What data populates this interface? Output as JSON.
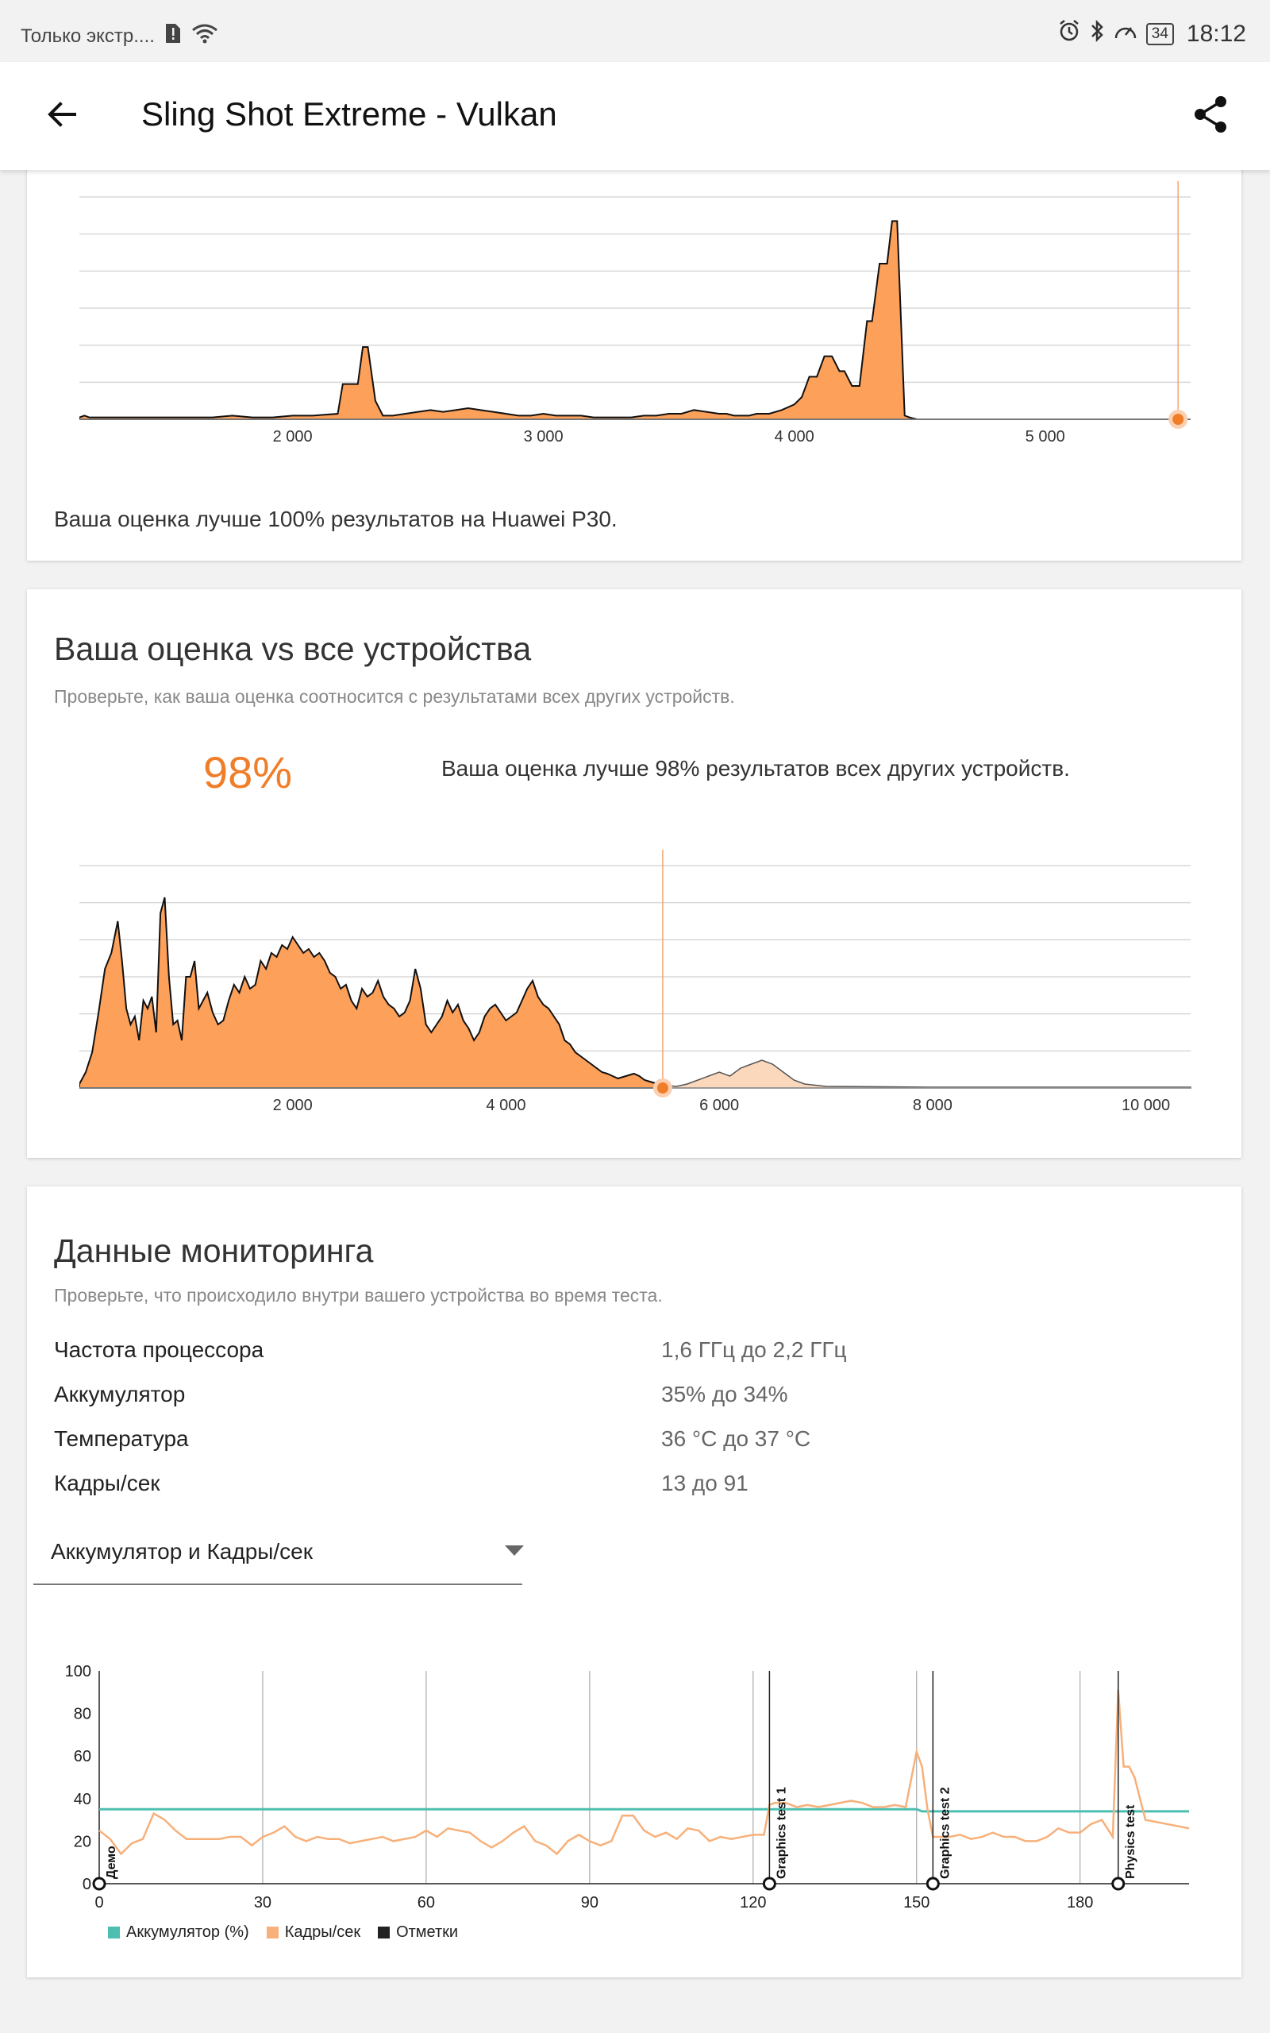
{
  "status_bar": {
    "carrier_text": "Только экстр....",
    "time": "18:12",
    "battery_level": "34"
  },
  "app_bar": {
    "title": "Sling Shot Extreme - Vulkan"
  },
  "card_model": {
    "summary": "Ваша оценка лучше 100% результатов на Huawei P30.",
    "chart_data": {
      "type": "area",
      "xticks": [
        "2 000",
        "3 000",
        "4 000",
        "5 000"
      ],
      "xlim": [
        1150,
        5580
      ],
      "x": [
        1150,
        1170,
        1190,
        1600,
        1680,
        1760,
        1840,
        1920,
        2000,
        2080,
        2180,
        2200,
        2230,
        2260,
        2280,
        2300,
        2330,
        2360,
        2400,
        2450,
        2500,
        2550,
        2600,
        2650,
        2700,
        2750,
        2800,
        2850,
        2900,
        2950,
        3000,
        3050,
        3100,
        3150,
        3200,
        3250,
        3300,
        3350,
        3400,
        3450,
        3500,
        3550,
        3600,
        3650,
        3700,
        3730,
        3760,
        3790,
        3820,
        3850,
        3900,
        3950,
        4000,
        4030,
        4060,
        4090,
        4120,
        4150,
        4180,
        4200,
        4230,
        4260,
        4290,
        4310,
        4340,
        4370,
        4390,
        4410,
        4440,
        4460,
        4490,
        5580
      ],
      "values": [
        1,
        2,
        1,
        1,
        1,
        2,
        1,
        1,
        2,
        2,
        3,
        19,
        19,
        19,
        39,
        39,
        10,
        2,
        2,
        3,
        4,
        5,
        4,
        5,
        6,
        5,
        4,
        3,
        2,
        2,
        3,
        2,
        2,
        2,
        1,
        1,
        1,
        1,
        2,
        2,
        3,
        3,
        5,
        4,
        3,
        3,
        2,
        2,
        2,
        3,
        3,
        5,
        8,
        12,
        23,
        23,
        34,
        34,
        26,
        26,
        18,
        18,
        53,
        53,
        84,
        84,
        107,
        107,
        2,
        1,
        0,
        0
      ],
      "ylim": [
        0,
        120
      ],
      "marker_x": 5530
    }
  },
  "card_all": {
    "heading": "Ваша оценка vs все устройства",
    "subtitle": "Проверьте, как ваша оценка соотносится с результатами всех других устройств.",
    "percentile": "98%",
    "summary": "Ваша оценка лучше 98% результатов всех других устройств.",
    "chart_data": {
      "type": "area",
      "xticks": [
        "2 000",
        "4 000",
        "6 000",
        "8 000",
        "10 000"
      ],
      "xlim": [
        0,
        10420
      ],
      "x": [
        0,
        60,
        120,
        180,
        240,
        300,
        360,
        400,
        440,
        480,
        520,
        560,
        600,
        640,
        680,
        720,
        760,
        800,
        840,
        880,
        920,
        960,
        1000,
        1040,
        1080,
        1120,
        1160,
        1200,
        1250,
        1300,
        1350,
        1400,
        1450,
        1500,
        1550,
        1600,
        1650,
        1700,
        1750,
        1800,
        1850,
        1900,
        1950,
        2000,
        2050,
        2100,
        2150,
        2200,
        2250,
        2300,
        2350,
        2400,
        2450,
        2500,
        2550,
        2600,
        2650,
        2700,
        2750,
        2800,
        2850,
        2900,
        2950,
        3000,
        3050,
        3100,
        3150,
        3200,
        3250,
        3300,
        3350,
        3400,
        3450,
        3500,
        3550,
        3600,
        3650,
        3700,
        3750,
        3800,
        3850,
        3900,
        3950,
        4000,
        4050,
        4100,
        4150,
        4200,
        4250,
        4300,
        4350,
        4400,
        4450,
        4500,
        4550,
        4600,
        4650,
        4700,
        4750,
        4800,
        4850,
        4900,
        4950,
        5000,
        5050,
        5100,
        5150,
        5200,
        5250,
        5300,
        5350,
        5400,
        5450,
        5500,
        5600,
        5700,
        5800,
        5900,
        6000,
        6100,
        6200,
        6300,
        6400,
        6500,
        6600,
        6700,
        6800,
        7000,
        8000,
        9000,
        10000,
        10420
      ],
      "values": [
        5,
        20,
        45,
        95,
        150,
        170,
        210,
        160,
        100,
        80,
        90,
        60,
        110,
        100,
        115,
        70,
        220,
        240,
        140,
        80,
        85,
        60,
        140,
        140,
        160,
        100,
        110,
        120,
        95,
        80,
        85,
        110,
        130,
        120,
        140,
        125,
        130,
        160,
        150,
        170,
        165,
        180,
        175,
        190,
        180,
        170,
        175,
        165,
        170,
        160,
        145,
        140,
        125,
        130,
        110,
        100,
        125,
        115,
        120,
        135,
        115,
        105,
        100,
        90,
        95,
        110,
        150,
        125,
        80,
        70,
        80,
        90,
        110,
        95,
        105,
        85,
        75,
        60,
        70,
        90,
        100,
        105,
        95,
        85,
        90,
        95,
        110,
        125,
        135,
        115,
        105,
        100,
        90,
        80,
        60,
        55,
        45,
        40,
        35,
        30,
        25,
        20,
        18,
        15,
        12,
        14,
        16,
        18,
        15,
        10,
        8,
        6,
        4,
        3,
        2,
        5,
        10,
        15,
        20,
        15,
        25,
        30,
        35,
        30,
        20,
        10,
        5,
        2,
        1,
        1,
        1,
        1,
        1
      ],
      "highlight_from_x": 5470,
      "ylim": [
        0,
        280
      ],
      "marker_x": 5470
    }
  },
  "monitoring": {
    "heading": "Данные мониторинга",
    "subtitle": "Проверьте, что происходило внутри вашего устройства во время теста.",
    "rows": [
      {
        "label": "Частота процессора",
        "value": "1,6 ГГц до 2,2 ГГц"
      },
      {
        "label": "Аккумулятор",
        "value": "35% до 34%"
      },
      {
        "label": "Температура",
        "value": "36 °C до 37 °C"
      },
      {
        "label": "Кадры/сек",
        "value": "13 до 91"
      }
    ],
    "dropdown_label": "Аккумулятор и Кадры/сек",
    "legend": [
      {
        "label": "Аккумулятор (%)",
        "color": "#4dbfb0"
      },
      {
        "label": "Кадры/сек",
        "color": "#f7b07a"
      },
      {
        "label": "Отметки",
        "color": "#222222"
      }
    ],
    "chart_data": {
      "type": "line",
      "xlim": [
        0,
        200
      ],
      "ylim": [
        0,
        100
      ],
      "xticks": [
        "0",
        "30",
        "60",
        "90",
        "120",
        "150",
        "180"
      ],
      "yticks": [
        "0",
        "20",
        "40",
        "60",
        "80",
        "100"
      ],
      "markers": [
        {
          "x": 0,
          "label": "Демо"
        },
        {
          "x": 123,
          "label": "Graphics test 1"
        },
        {
          "x": 153,
          "label": "Graphics test 2"
        },
        {
          "x": 187,
          "label": "Physics test"
        }
      ],
      "series": [
        {
          "name": "Аккумулятор (%)",
          "color": "#4dbfb0",
          "x": [
            0,
            150,
            151,
            200
          ],
          "values": [
            35,
            35,
            34,
            34
          ]
        },
        {
          "name": "Кадры/сек",
          "color": "#f7b07a",
          "x": [
            0,
            2,
            4,
            6,
            8,
            10,
            12,
            14,
            16,
            18,
            20,
            22,
            24,
            26,
            28,
            30,
            32,
            34,
            36,
            38,
            40,
            42,
            44,
            46,
            48,
            50,
            52,
            54,
            56,
            58,
            60,
            62,
            64,
            66,
            68,
            70,
            72,
            74,
            76,
            78,
            80,
            82,
            84,
            86,
            88,
            90,
            92,
            94,
            96,
            98,
            100,
            102,
            104,
            106,
            108,
            110,
            112,
            114,
            116,
            118,
            120,
            122,
            123,
            124,
            126,
            128,
            130,
            132,
            134,
            136,
            138,
            140,
            142,
            144,
            146,
            148,
            150,
            151,
            152,
            153,
            154,
            156,
            158,
            160,
            162,
            164,
            166,
            168,
            170,
            172,
            174,
            176,
            178,
            180,
            182,
            184,
            186,
            187,
            188,
            189,
            190,
            192,
            194,
            196,
            198,
            200
          ],
          "values": [
            25,
            21,
            14,
            19,
            21,
            33,
            30,
            25,
            21,
            21,
            21,
            21,
            22,
            22,
            18,
            22,
            24,
            27,
            22,
            20,
            22,
            21,
            21,
            19,
            20,
            21,
            22,
            20,
            21,
            22,
            25,
            22,
            26,
            25,
            24,
            20,
            17,
            20,
            24,
            27,
            20,
            18,
            14,
            20,
            23,
            20,
            18,
            20,
            32,
            32,
            25,
            22,
            24,
            21,
            26,
            25,
            20,
            22,
            21,
            22,
            23,
            23,
            37,
            38,
            38,
            36,
            37,
            36,
            37,
            38,
            39,
            38,
            36,
            36,
            37,
            36,
            62,
            55,
            35,
            22,
            22,
            22,
            23,
            21,
            22,
            24,
            22,
            22,
            20,
            20,
            22,
            26,
            24,
            24,
            28,
            30,
            22,
            91,
            55,
            55,
            50,
            30,
            29,
            28,
            27,
            26
          ]
        }
      ]
    }
  }
}
